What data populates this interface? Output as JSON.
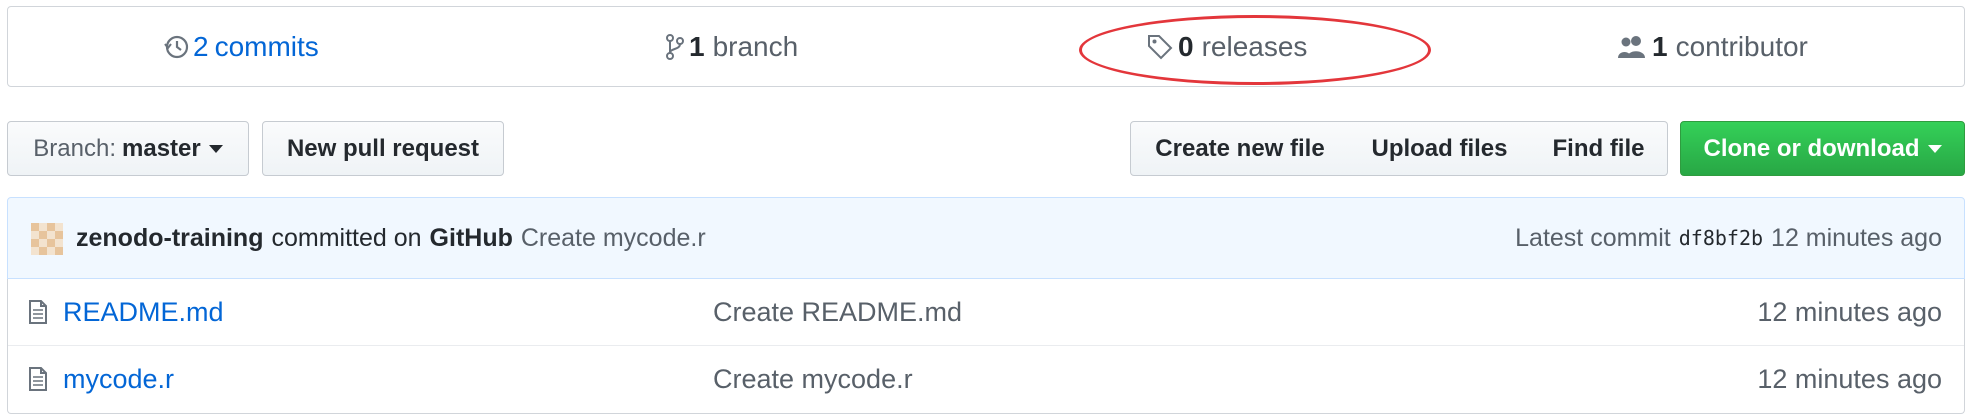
{
  "summary": {
    "commits": {
      "count": "2",
      "label": "commits",
      "icon": "history-icon"
    },
    "branches": {
      "count": "1",
      "label": "branch",
      "icon": "git-branch-icon"
    },
    "releases": {
      "count": "0",
      "label": "releases",
      "icon": "tag-icon"
    },
    "contributors": {
      "count": "1",
      "label": "contributor",
      "icon": "people-icon"
    },
    "highlight_color": "#e3363b"
  },
  "toolbar": {
    "branch_prefix": "Branch:",
    "branch_name": "master",
    "new_pull_request": "New pull request",
    "create_new_file": "Create new file",
    "upload_files": "Upload files",
    "find_file": "Find file",
    "clone_or_download": "Clone or download",
    "clone_color": "#28a745"
  },
  "latest_commit": {
    "author": "zenodo-training",
    "committed_on": "committed on",
    "platform": "GitHub",
    "message": "Create mycode.r",
    "label": "Latest commit",
    "sha": "df8bf2b",
    "age": "12 minutes ago"
  },
  "files": [
    {
      "name": "README.md",
      "message": "Create README.md",
      "age": "12 minutes ago",
      "icon": "file-icon"
    },
    {
      "name": "mycode.r",
      "message": "Create mycode.r",
      "age": "12 minutes ago",
      "icon": "file-icon"
    }
  ],
  "colors": {
    "link": "#0366d6",
    "muted": "#586069",
    "commit_bar_bg": "#f1f8ff"
  }
}
